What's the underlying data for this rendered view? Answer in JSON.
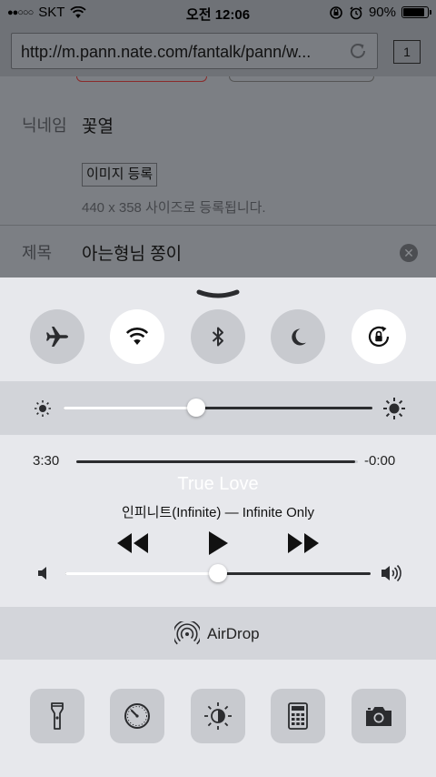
{
  "status": {
    "carrier": "SKT",
    "signal_dots": "●●○○○",
    "time": "오전 12:06",
    "battery_percent": "90%",
    "battery_level": 0.9
  },
  "browser": {
    "url": "http://m.pann.nate.com/fantalk/pann/w...",
    "tab_count": "1"
  },
  "form": {
    "nickname_label": "닉네임",
    "nickname_value": "꽃열",
    "image_button": "이미지 등록",
    "image_hint": "440 x 358 사이즈로 등록됩니다.",
    "title_label": "제목",
    "title_value": "아는형님 쫑이"
  },
  "toggles": [
    {
      "name": "airplane-mode",
      "icon": "airplane-icon",
      "on": false
    },
    {
      "name": "wifi",
      "icon": "wifi-icon",
      "on": true
    },
    {
      "name": "bluetooth",
      "icon": "bluetooth-icon",
      "on": false
    },
    {
      "name": "do-not-disturb",
      "icon": "moon-icon",
      "on": false
    },
    {
      "name": "rotation-lock",
      "icon": "rotation-lock-icon",
      "on": true
    }
  ],
  "brightness": {
    "level": 0.43
  },
  "now_playing": {
    "elapsed": "3:30",
    "remaining": "-0:00",
    "progress": 0.99,
    "title": "True Love",
    "artist_album": "인피니트(Infinite) — Infinite Only",
    "volume": 0.5
  },
  "airdrop": {
    "label": "AirDrop"
  },
  "tools": [
    "flashlight-icon",
    "timer-icon",
    "night-shift-icon",
    "calculator-icon",
    "camera-icon"
  ]
}
